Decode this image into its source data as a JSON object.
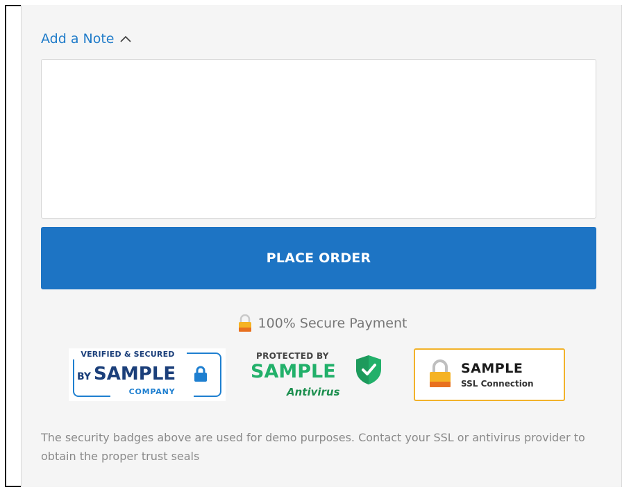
{
  "note": {
    "toggle_label": "Add a Note",
    "toggle_icon": "chevron-up-icon",
    "textarea_value": "",
    "textarea_placeholder": ""
  },
  "order": {
    "button_label": "PLACE ORDER"
  },
  "secure": {
    "icon": "lock-icon",
    "label": "100% Secure Payment"
  },
  "badges": {
    "verified": {
      "top": "VERIFIED & SECURED",
      "by": "BY",
      "main": "SAMPLE",
      "bottom": "COMPANY"
    },
    "antivirus": {
      "top": "PROTECTED BY",
      "main": "SAMPLE",
      "sub": "Antivirus"
    },
    "ssl": {
      "main": "SAMPLE",
      "sub": "SSL Connection"
    }
  },
  "disclaimer": "The security badges above are used for demo purposes. Contact your SSL or antivirus provider to obtain the proper trust seals",
  "colors": {
    "accent": "#1d74c4",
    "link": "#1f7bc9",
    "panel_bg": "#f5f5f5",
    "lock_gold": "#f2b22a",
    "antivirus_green": "#22b06a"
  }
}
